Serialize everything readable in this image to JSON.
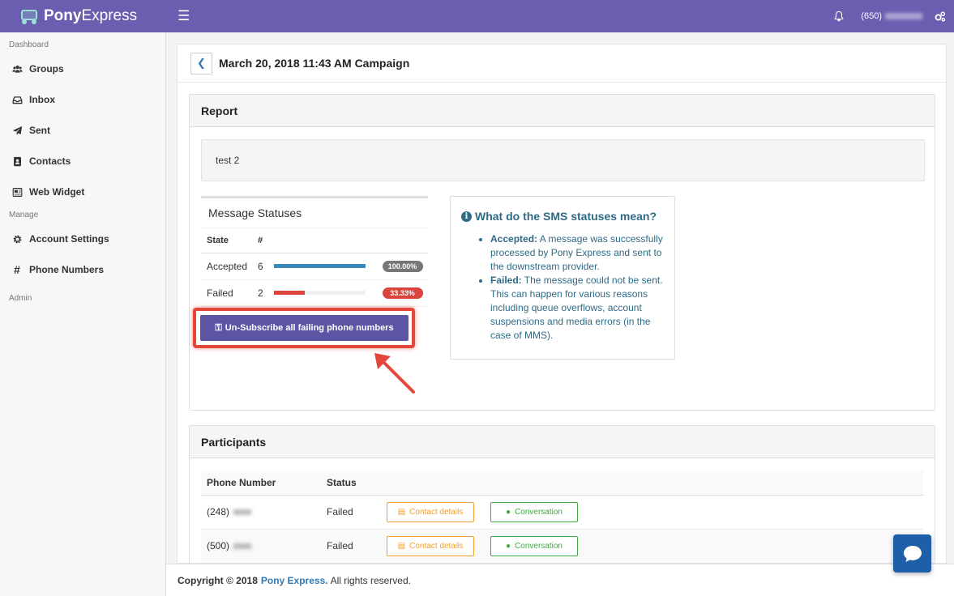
{
  "header": {
    "brand_bold": "Pony",
    "brand_light": "Express",
    "phone_prefix": "(650)"
  },
  "sidebar": {
    "section_dashboard": "Dashboard",
    "section_manage": "Manage",
    "section_admin": "Admin",
    "items": [
      {
        "label": "Groups",
        "icon": "users-icon"
      },
      {
        "label": "Inbox",
        "icon": "inbox-icon"
      },
      {
        "label": "Sent",
        "icon": "paper-plane-icon"
      },
      {
        "label": "Contacts",
        "icon": "address-book-icon"
      },
      {
        "label": "Web Widget",
        "icon": "widget-icon"
      },
      {
        "label": "Account Settings",
        "icon": "gear-icon"
      },
      {
        "label": "Phone Numbers",
        "icon": "hashtag-icon"
      }
    ]
  },
  "page": {
    "title": "March 20, 2018 11:43 AM Campaign"
  },
  "report": {
    "heading": "Report",
    "message": "test 2",
    "statuses_title": "Message Statuses",
    "col_state": "State",
    "col_count": "#",
    "rows": [
      {
        "state": "Accepted",
        "count": "6",
        "fraction": 1.0,
        "percent_label": "100.00%",
        "color": "#3a89b8",
        "badge_color": "#777777"
      },
      {
        "state": "Failed",
        "count": "2",
        "fraction": 0.3333,
        "percent_label": "33.33%",
        "color": "#d9453d",
        "badge_color": "#d9453d"
      }
    ],
    "unsubscribe_label": "Un-Subscribe all failing phone numbers"
  },
  "info": {
    "title": "What do the SMS statuses mean?",
    "accepted_term": "Accepted:",
    "accepted_text": " A message was successfully processed by Pony Express and sent to the downstream provider.",
    "failed_term": "Failed:",
    "failed_text": " The message could not be sent. This can happen for various reasons including queue overflows, account suspensions and media errors (in the case of MMS)."
  },
  "participants": {
    "heading": "Participants",
    "col_phone": "Phone Number",
    "col_status": "Status",
    "rows": [
      {
        "phone_prefix": "(248)",
        "status": "Failed"
      },
      {
        "phone_prefix": "(500)",
        "status": "Failed"
      }
    ],
    "contact_label": "Contact details",
    "conversation_label": "Conversation"
  },
  "footer": {
    "copyright": "Copyright © 2018",
    "company": "Pony Express.",
    "rest": "All rights reserved."
  },
  "colors": {
    "topbar": "#6a5eb0",
    "button": "#5c55a6",
    "highlight": "#e2473a"
  }
}
